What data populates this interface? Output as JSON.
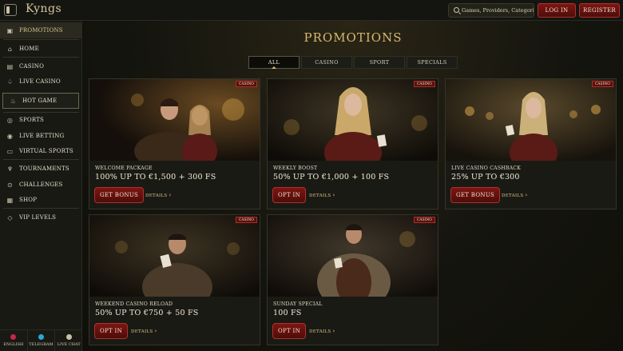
{
  "header": {
    "logo_text": "Kyngs",
    "search_placeholder": "Games, Providers, Categories",
    "login_label": "LOG IN",
    "register_label": "REGISTER"
  },
  "sidebar": {
    "items": [
      {
        "label": "PROMOTIONS",
        "icon": "gift-icon"
      },
      {
        "label": "HOME",
        "icon": "home-icon"
      },
      {
        "label": "CASINO",
        "icon": "cards-icon"
      },
      {
        "label": "LIVE CASINO",
        "icon": "live-cards-icon"
      },
      {
        "label": "HOT GAME",
        "icon": "flame-icon"
      },
      {
        "label": "SPORTS",
        "icon": "ball-icon"
      },
      {
        "label": "LIVE BETTING",
        "icon": "live-bet-icon"
      },
      {
        "label": "VIRTUAL SPORTS",
        "icon": "monitor-icon"
      },
      {
        "label": "TOURNAMENTS",
        "icon": "trophy-icon"
      },
      {
        "label": "CHALLENGES",
        "icon": "target-icon"
      },
      {
        "label": "SHOP",
        "icon": "shop-icon"
      },
      {
        "label": "VIP LEVELS",
        "icon": "diamond-icon"
      }
    ],
    "footer": [
      {
        "label": "ENGLISH",
        "color": "#c6264a"
      },
      {
        "label": "TELEGRAM",
        "color": "#2ea5dd"
      },
      {
        "label": "LIVE CHAT",
        "color": "#c9c1a5"
      }
    ]
  },
  "main": {
    "title": "PROMOTIONS",
    "tabs": [
      "ALL",
      "CASINO",
      "SPORT",
      "SPECIALS"
    ],
    "active_tab": "ALL",
    "cards": [
      {
        "badge": "CASINO",
        "subtitle": "WELCOME PACKAGE",
        "headline": "100% UP TO €1,500 + 300 FS",
        "cta": "GET BONUS",
        "details": "DETAILS"
      },
      {
        "badge": "CASINO",
        "subtitle": "WEEKLY BOOST",
        "headline": "50% UP TO €1,000 + 100 FS",
        "cta": "OPT IN",
        "details": "DETAILS"
      },
      {
        "badge": "CASINO",
        "subtitle": "LIVE CASINO CASHBACK",
        "headline": "25% UP TO €300",
        "cta": "GET BONUS",
        "details": "DETAILS"
      },
      {
        "badge": "CASINO",
        "subtitle": "WEEKEND CASINO RELOAD",
        "headline": "50% UP TO €750 + 50 FS",
        "cta": "OPT IN",
        "details": "DETAILS"
      },
      {
        "badge": "CASINO",
        "subtitle": "SUNDAY SPECIAL",
        "headline": "100 FS",
        "cta": "OPT IN",
        "details": "DETAILS"
      }
    ]
  },
  "colors": {
    "accent_gold": "#d8b870",
    "button_red": "#7d1512",
    "background": "#0f100d"
  }
}
